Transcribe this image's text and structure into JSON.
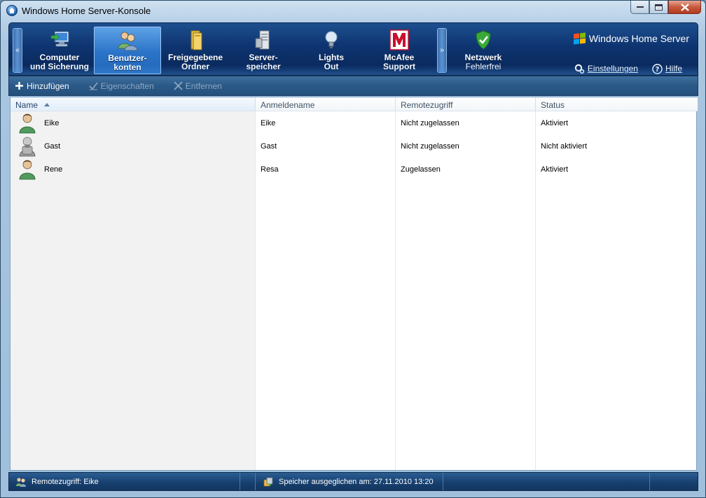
{
  "window": {
    "title": "Windows Home Server-Konsole"
  },
  "nav": {
    "scroll_left": "«",
    "scroll_right": "»",
    "tabs": [
      {
        "label": "Computer\nund Sicherung",
        "icon": "computer-backup-icon",
        "active": false
      },
      {
        "label": "Benutzer-\nkonten",
        "icon": "user-accounts-icon",
        "active": true
      },
      {
        "label": "Freigegebene\nOrdner",
        "icon": "shared-folders-icon",
        "active": false
      },
      {
        "label": "Server-\nspeicher",
        "icon": "server-storage-icon",
        "active": false
      },
      {
        "label": "Lights\nOut",
        "icon": "lightbulb-icon",
        "active": false
      },
      {
        "label": "McAfee\nSupport",
        "icon": "mcafee-icon",
        "active": false
      }
    ],
    "network": {
      "label": "Netzwerk",
      "status": "Fehlerfrei",
      "icon": "shield-check-icon"
    },
    "brand": "Windows Home Server",
    "settings_label": "Einstellungen",
    "help_label": "Hilfe"
  },
  "actions": {
    "add": "Hinzufügen",
    "properties": "Eigenschaften",
    "remove": "Entfernen"
  },
  "table": {
    "columns": [
      "Name",
      "Anmeldename",
      "Remotezugriff",
      "Status"
    ],
    "sorted_column": "Name",
    "rows": [
      {
        "name": "Eike",
        "login": "Eike",
        "remote": "Nicht zugelassen",
        "status": "Aktiviert",
        "icon": "user-active-icon"
      },
      {
        "name": "Gast",
        "login": "Gast",
        "remote": "Nicht zugelassen",
        "status": "Nicht aktiviert",
        "icon": "user-guest-icon"
      },
      {
        "name": "Rene",
        "login": "Resa",
        "remote": "Zugelassen",
        "status": "Aktiviert",
        "icon": "user-active-icon"
      }
    ]
  },
  "statusbar": {
    "remote": "Remotezugriff: Eike",
    "storage": "Speicher ausgeglichen am: 27.11.2010 13:20"
  },
  "colors": {
    "nav_dark": "#0e3470",
    "active_tab": "#2a73c7",
    "shield_green": "#3aa93a",
    "mcafee_red": "#c8102e"
  }
}
